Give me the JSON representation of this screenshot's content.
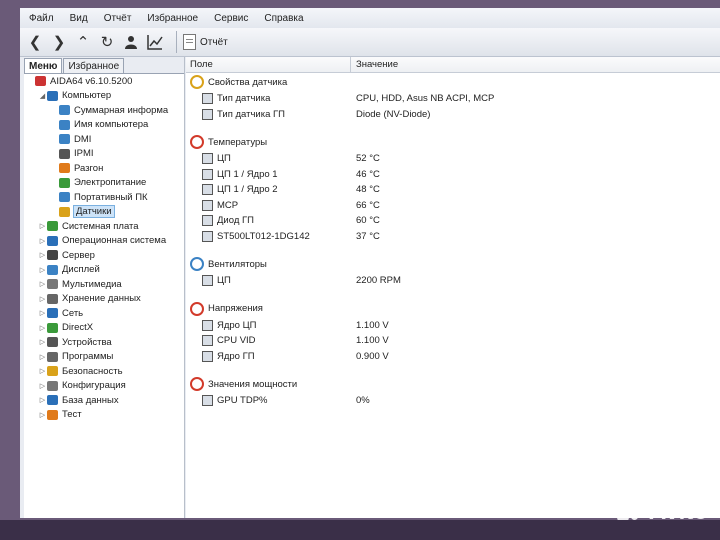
{
  "menu": [
    "Файл",
    "Вид",
    "Отчёт",
    "Избранное",
    "Сервис",
    "Справка"
  ],
  "toolbar": {
    "icons": [
      "back-icon",
      "forward-icon",
      "up-icon",
      "refresh-icon",
      "user-icon",
      "chart-icon"
    ],
    "report_label": "Отчёт"
  },
  "tabs": {
    "menu": "Меню",
    "favorites": "Избранное"
  },
  "tree": [
    {
      "label": "AIDA64 v6.10.5200",
      "indent": 0,
      "color": "#c33"
    },
    {
      "label": "Компьютер",
      "indent": 1,
      "color": "#2a6fb8",
      "expanded": true
    },
    {
      "label": "Суммарная информа",
      "indent": 2,
      "color": "#3b82c4"
    },
    {
      "label": "Имя компьютера",
      "indent": 2,
      "color": "#3b82c4"
    },
    {
      "label": "DMI",
      "indent": 2,
      "color": "#3b82c4"
    },
    {
      "label": "IPMI",
      "indent": 2,
      "color": "#555"
    },
    {
      "label": "Разгон",
      "indent": 2,
      "color": "#e07a1a"
    },
    {
      "label": "Электропитание",
      "indent": 2,
      "color": "#3a9a3a"
    },
    {
      "label": "Портативный ПК",
      "indent": 2,
      "color": "#3b82c4"
    },
    {
      "label": "Датчики",
      "indent": 2,
      "color": "#d9a21a",
      "selected": true
    },
    {
      "label": "Системная плата",
      "indent": 1,
      "color": "#3a9a3a",
      "collapsed": true
    },
    {
      "label": "Операционная система",
      "indent": 1,
      "color": "#2a6fb8",
      "collapsed": true
    },
    {
      "label": "Сервер",
      "indent": 1,
      "color": "#444",
      "collapsed": true
    },
    {
      "label": "Дисплей",
      "indent": 1,
      "color": "#3b82c4",
      "collapsed": true
    },
    {
      "label": "Мультимедиа",
      "indent": 1,
      "color": "#777",
      "collapsed": true
    },
    {
      "label": "Хранение данных",
      "indent": 1,
      "color": "#666",
      "collapsed": true
    },
    {
      "label": "Сеть",
      "indent": 1,
      "color": "#2a6fb8",
      "collapsed": true
    },
    {
      "label": "DirectX",
      "indent": 1,
      "color": "#3a9a3a",
      "collapsed": true
    },
    {
      "label": "Устройства",
      "indent": 1,
      "color": "#555",
      "collapsed": true
    },
    {
      "label": "Программы",
      "indent": 1,
      "color": "#666",
      "collapsed": true
    },
    {
      "label": "Безопасность",
      "indent": 1,
      "color": "#d9a21a",
      "collapsed": true
    },
    {
      "label": "Конфигурация",
      "indent": 1,
      "color": "#777",
      "collapsed": true
    },
    {
      "label": "База данных",
      "indent": 1,
      "color": "#2a6fb8",
      "collapsed": true
    },
    {
      "label": "Тест",
      "indent": 1,
      "color": "#e07a1a",
      "collapsed": true
    }
  ],
  "columns": {
    "field": "Поле",
    "value": "Значение"
  },
  "groups": [
    {
      "title": "Свойства датчика",
      "icon_color": "#d9a21a",
      "rows": [
        {
          "field": "Тип датчика",
          "value": "CPU, HDD, Asus NB ACPI, MCP"
        },
        {
          "field": "Тип датчика ГП",
          "value": "Diode  (NV-Diode)"
        }
      ]
    },
    {
      "title": "Температуры",
      "icon_color": "#d23a2a",
      "rows": [
        {
          "field": "ЦП",
          "value": "52 °C"
        },
        {
          "field": "ЦП 1 / Ядро 1",
          "value": "46 °C"
        },
        {
          "field": "ЦП 1 / Ядро 2",
          "value": "48 °C"
        },
        {
          "field": "MCP",
          "value": "66 °C"
        },
        {
          "field": "Диод ГП",
          "value": "60 °C"
        },
        {
          "field": "ST500LT012-1DG142",
          "value": "37 °C"
        }
      ]
    },
    {
      "title": "Вентиляторы",
      "icon_color": "#3b82c4",
      "rows": [
        {
          "field": "ЦП",
          "value": "2200 RPM"
        }
      ]
    },
    {
      "title": "Напряжения",
      "icon_color": "#d23a2a",
      "rows": [
        {
          "field": "Ядро ЦП",
          "value": "1.100 V"
        },
        {
          "field": "CPU VID",
          "value": "1.100 V"
        },
        {
          "field": "Ядро ГП",
          "value": "0.900 V"
        }
      ]
    },
    {
      "title": "Значения мощности",
      "icon_color": "#d23a2a",
      "rows": [
        {
          "field": "GPU TDP%",
          "value": "0%"
        }
      ]
    }
  ],
  "watermark": "Avito"
}
